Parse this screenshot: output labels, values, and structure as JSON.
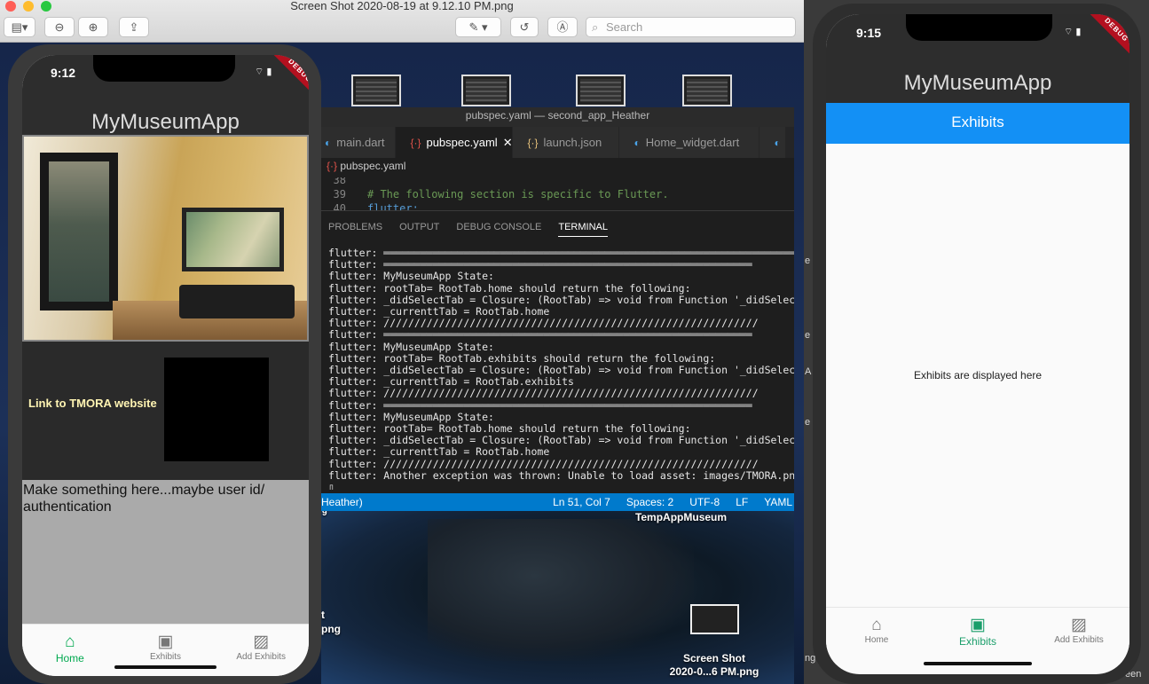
{
  "preview": {
    "title": "Screen Shot 2020-08-19 at 9.12.10 PM.png",
    "search_placeholder": "Search",
    "colors": {
      "close": "#ff5f57",
      "minimize": "#febc2e",
      "zoom": "#28c840"
    },
    "toolbar": {
      "sidebar": "sidebar-icon",
      "zoom_out": "zoom-out-icon",
      "zoom_in": "zoom-in-icon",
      "share": "share-icon",
      "markup": "markup-icon",
      "rotate": "rotate-icon",
      "annotate": "annotate-icon"
    }
  },
  "desktop": {
    "folder_label": "TempAppMuseum",
    "file_label_line1": "Screen Shot",
    "file_label_line2": "2020-0...6 PM.png",
    "left_frag_1": "t",
    "left_frag_2": "png",
    "left_frag_3": "9"
  },
  "vscode": {
    "window_title": "pubspec.yaml — second_app_Heather",
    "tabs": [
      "main.dart",
      "pubspec.yaml",
      "launch.json",
      "Home_widget.dart"
    ],
    "active_tab_close": "✕",
    "breadcrumb": "pubspec.yaml",
    "code_lines": [
      {
        "num": "38",
        "text": ""
      },
      {
        "num": "39",
        "text": "# The following section is specific to Flutter."
      },
      {
        "num": "40",
        "text": "flutter:"
      }
    ],
    "panel_tabs": [
      "PROBLEMS",
      "OUTPUT",
      "DEBUG CONSOLE",
      "TERMINAL"
    ],
    "terminal_lines": [
      "flutter: ══════════════════════════════════════════════════════════════════════════",
      "flutter: ════════════════════════════════════════════════════════════",
      "flutter: MyMuseumApp State:",
      "flutter: rootTab= RootTab.home should return the following:",
      "flutter: _didSelectTab = Closure: (RootTab) => void from Function '_didSelectTab",
      "flutter: _currenttTab = RootTab.home",
      "flutter: /////////////////////////////////////////////////////////////",
      "flutter: ════════════════════════════════════════════════════════════",
      "flutter: MyMuseumApp State:",
      "flutter: rootTab= RootTab.exhibits should return the following:",
      "flutter: _didSelectTab = Closure: (RootTab) => void from Function '_didSelectTab",
      "flutter: _currenttTab = RootTab.exhibits",
      "flutter: /////////////////////////////////////////////////////////////",
      "flutter: ════════════════════════════════════════════════════════════",
      "flutter: MyMuseumApp State:",
      "flutter: rootTab= RootTab.home should return the following:",
      "flutter: _didSelectTab = Closure: (RootTab) => void from Function '_didSelectTab",
      "flutter: _currenttTab = RootTab.home",
      "flutter: /////////////////////////////////////////////////////////////",
      "flutter: Another exception was thrown: Unable to load asset: images/TMORA.png",
      "▯"
    ],
    "status_left": "Heather)",
    "status_items": [
      "Ln 51, Col 7",
      "Spaces: 2",
      "UTF-8",
      "LF",
      "YAML"
    ]
  },
  "left_phone": {
    "time": "9:12",
    "debug": "DEBUG",
    "app_title": "MyMuseumApp",
    "link_text": "Link to TMORA website",
    "placeholder_text": "Make something here...maybe user id/ authentication",
    "nav": [
      {
        "label": "Home",
        "icon": "home-icon",
        "glyph": "⌂"
      },
      {
        "label": "Exhibits",
        "icon": "photo-library-icon",
        "glyph": "▣"
      },
      {
        "label": "Add Exhibits",
        "icon": "add-photo-icon",
        "glyph": "▨"
      }
    ],
    "active_color": "#00a84f"
  },
  "right_phone": {
    "time": "9:15",
    "debug": "DEBUG",
    "app_title": "MyMuseumApp",
    "tab_title": "Exhibits",
    "body_text": "Exhibits are displayed here",
    "nav": [
      {
        "label": "Home",
        "icon": "home-icon",
        "glyph": "⌂"
      },
      {
        "label": "Exhibits",
        "icon": "photo-library-icon",
        "glyph": "▣"
      },
      {
        "label": "Add Exhibits",
        "icon": "add-photo-icon",
        "glyph": "▨"
      }
    ],
    "tab_color": "#1390f5",
    "active_color": "#1a9e6a"
  },
  "right_edge": {
    "frags": [
      "e",
      "e",
      "A",
      "e",
      "ng",
      "een"
    ]
  }
}
